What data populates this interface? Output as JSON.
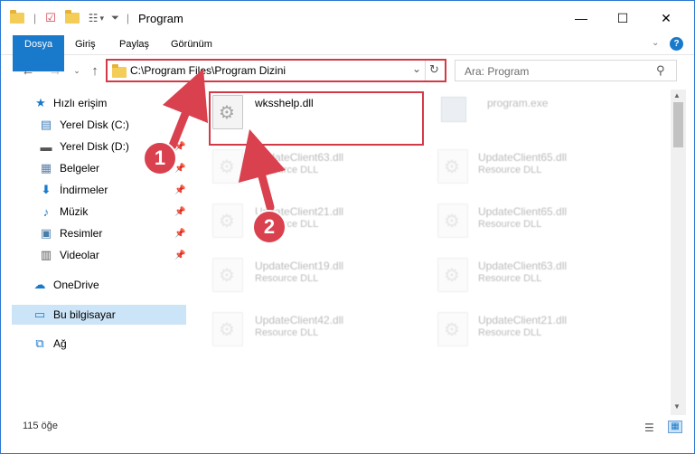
{
  "window": {
    "title": "Program"
  },
  "ribbon": {
    "tabs": [
      "Dosya",
      "Giriş",
      "Paylaş",
      "Görünüm"
    ]
  },
  "address": {
    "path": "C:\\Program Files\\Program Dizini",
    "search_placeholder": "Ara: Program"
  },
  "nav": {
    "items": [
      {
        "label": "Hızlı erişim",
        "icon": "star-icon"
      },
      {
        "label": "Yerel Disk (C:)",
        "icon": "drive-icon"
      },
      {
        "label": "Yerel Disk (D:)",
        "icon": "drive-icon"
      },
      {
        "label": "Belgeler",
        "icon": "documents-icon"
      },
      {
        "label": "İndirmeler",
        "icon": "download-icon"
      },
      {
        "label": "Müzik",
        "icon": "music-icon"
      },
      {
        "label": "Resimler",
        "icon": "pictures-icon"
      },
      {
        "label": "Videolar",
        "icon": "videos-icon"
      },
      {
        "label": "OneDrive",
        "icon": "cloud-icon"
      },
      {
        "label": "Bu bilgisayar",
        "icon": "computer-icon"
      },
      {
        "label": "Ağ",
        "icon": "network-icon"
      }
    ]
  },
  "content": {
    "highlighted_file": "wksshelp.dll",
    "top_right_file": "program.exe",
    "files": [
      {
        "name": "UpdateClient63.dll",
        "type": "Resource DLL"
      },
      {
        "name": "UpdateClient65.dll",
        "type": "Resource DLL"
      },
      {
        "name": "UpdateClient21.dll",
        "type": "Resource DLL"
      },
      {
        "name": "UpdateClient65.dll",
        "type": "Resource DLL"
      },
      {
        "name": "UpdateClient19.dll",
        "type": "Resource DLL"
      },
      {
        "name": "UpdateClient63.dll",
        "type": "Resource DLL"
      },
      {
        "name": "UpdateClient42.dll",
        "type": "Resource DLL"
      },
      {
        "name": "UpdateClient21.dll",
        "type": "Resource DLL"
      }
    ]
  },
  "status": {
    "count": "115 öğe"
  },
  "callouts": [
    "1",
    "2"
  ],
  "colors": {
    "accent": "#1979ca",
    "highlight": "#d23a47",
    "selected": "#cce4f7"
  }
}
